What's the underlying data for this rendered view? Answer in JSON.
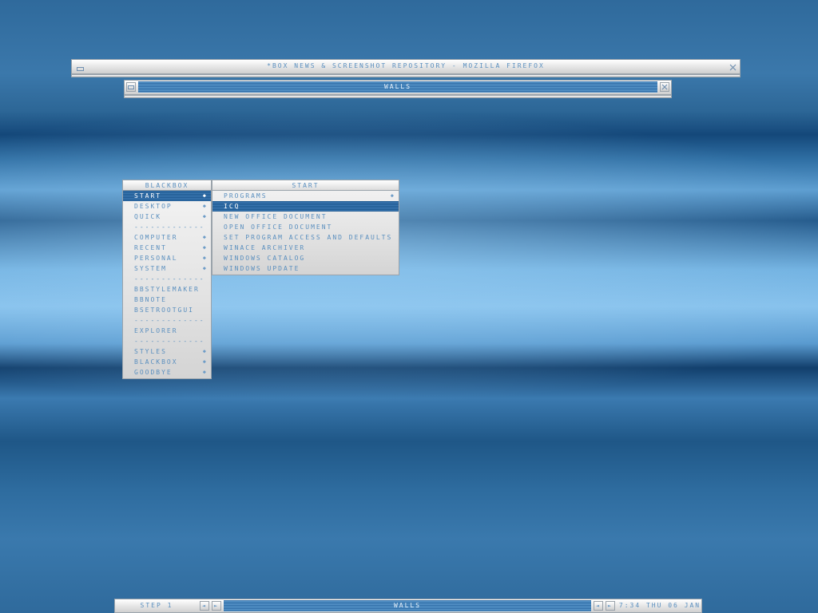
{
  "firefox_window": {
    "title": "*box news & screenshot repository - Mozilla Firefox"
  },
  "walls_window": {
    "title": "walls"
  },
  "root_menu": {
    "title": "blackbox",
    "items": [
      {
        "label": "start",
        "submenu": true,
        "active": true
      },
      {
        "label": "desktop",
        "submenu": true
      },
      {
        "label": "quick",
        "submenu": true
      },
      {
        "label": "-------------",
        "separator": true
      },
      {
        "label": "computer",
        "submenu": true
      },
      {
        "label": "recent",
        "submenu": true
      },
      {
        "label": "personal",
        "submenu": true
      },
      {
        "label": "system",
        "submenu": true
      },
      {
        "label": "-------------",
        "separator": true
      },
      {
        "label": "bbstylemaker"
      },
      {
        "label": "bbnote"
      },
      {
        "label": "bsetrootgui"
      },
      {
        "label": "-------------",
        "separator": true
      },
      {
        "label": "explorer"
      },
      {
        "label": "-------------",
        "separator": true
      },
      {
        "label": "styles",
        "submenu": true
      },
      {
        "label": "blackbox",
        "submenu": true
      },
      {
        "label": "goodbye",
        "submenu": true
      }
    ]
  },
  "start_menu": {
    "title": "start",
    "items": [
      {
        "label": "programs",
        "submenu": true
      },
      {
        "label": "icq",
        "active": true
      },
      {
        "label": "new office document"
      },
      {
        "label": "open office document"
      },
      {
        "label": "set program access and defaults"
      },
      {
        "label": "winace archiver"
      },
      {
        "label": "windows catalog"
      },
      {
        "label": "windows update"
      }
    ]
  },
  "toolbar": {
    "workspace": "step 1",
    "window_label": "walls",
    "clock": "7:34 thu 06 jan",
    "prev_glyph": "◄",
    "next_glyph": "►"
  },
  "icons": {
    "minimize": "minimize-icon",
    "close": "close-icon",
    "submenu_arrow": "diamond-arrow-icon"
  },
  "colors": {
    "accent_blue": "#2f6da6",
    "text_blue": "#5a8fbf",
    "bar_light": "#e6e6e6"
  }
}
